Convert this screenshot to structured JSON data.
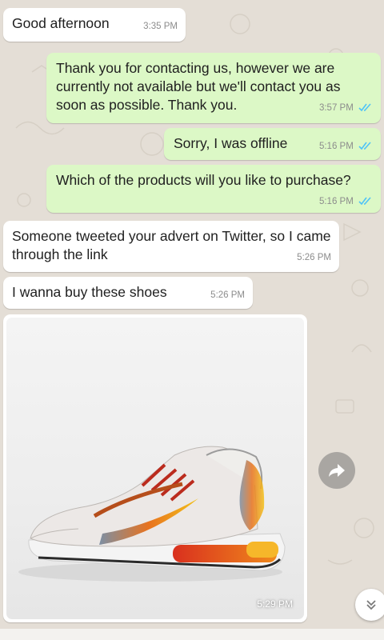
{
  "colors": {
    "incoming_bubble": "#ffffff",
    "outgoing_bubble": "#dcf8c6",
    "read_ticks": "#4fc3f7",
    "wallpaper": "#e4ded6"
  },
  "messages": [
    {
      "direction": "incoming",
      "text": "Good afternoon",
      "time": "3:35 PM"
    },
    {
      "direction": "outgoing",
      "text": "Thank you for contacting us, however we are currently not available but we'll contact you as soon as possible. Thank you.",
      "time": "3:57 PM",
      "status": "read"
    },
    {
      "direction": "outgoing",
      "text": "Sorry, I was offline",
      "time": "5:16 PM",
      "status": "read"
    },
    {
      "direction": "outgoing",
      "text": "Which of the products will you like to purchase?",
      "time": "5:16 PM",
      "status": "read"
    },
    {
      "direction": "incoming",
      "text": "Someone tweeted your advert on Twitter, so I came through the link",
      "time": "5:26 PM"
    },
    {
      "direction": "incoming",
      "text": "I wanna buy these shoes",
      "time": "5:26 PM"
    }
  ],
  "image_message": {
    "direction": "incoming",
    "content_icon": "sneaker-image",
    "time": "5:29 PM"
  },
  "controls": {
    "forward_icon": "forward-arrow-icon",
    "scroll_icon": "double-chevron-down-icon"
  }
}
